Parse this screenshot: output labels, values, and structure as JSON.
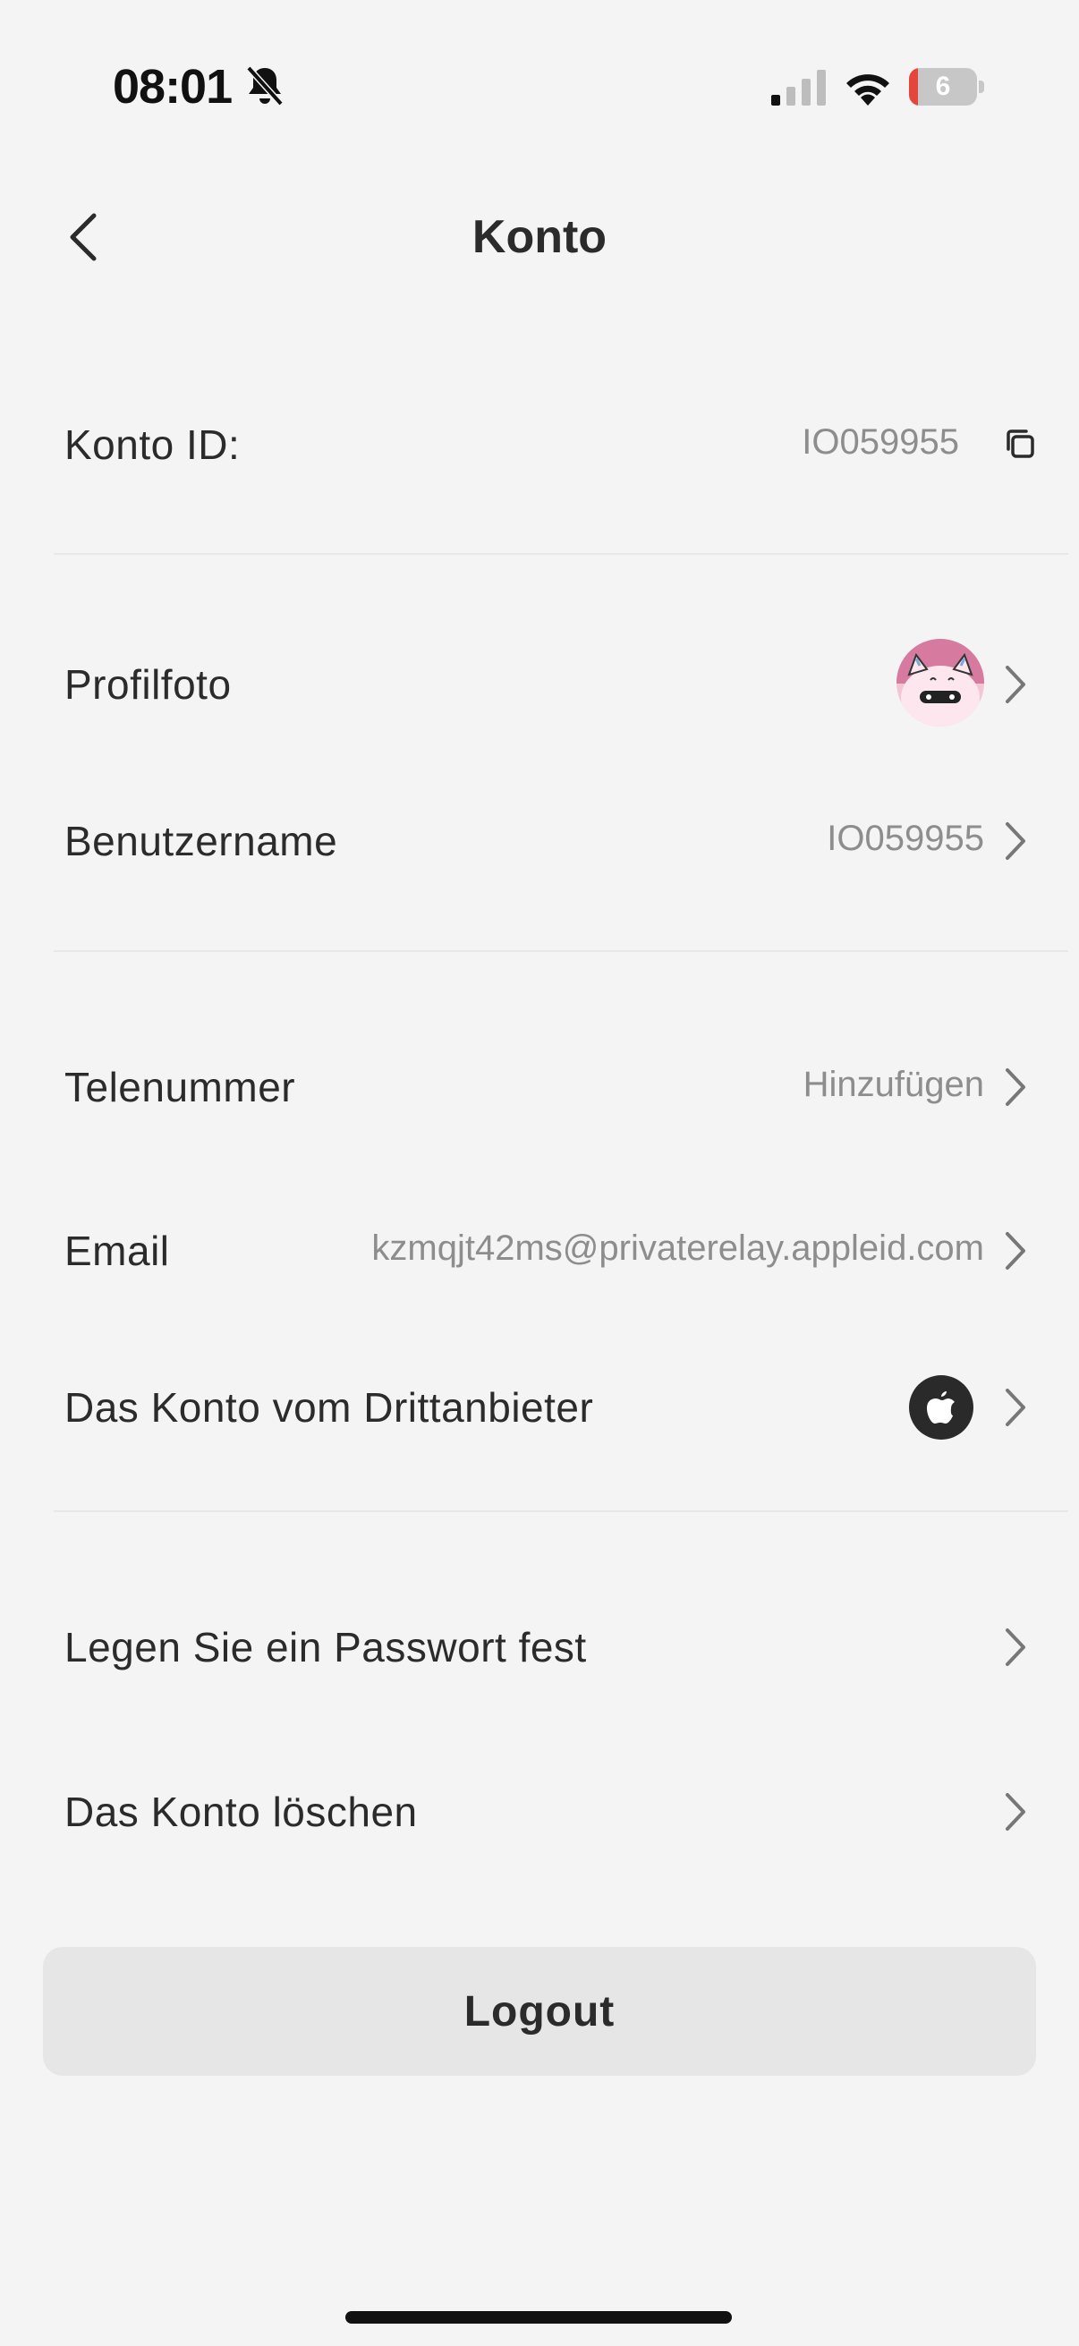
{
  "status_bar": {
    "time": "08:01",
    "battery_level": "6",
    "icons": [
      "bell-slash-icon",
      "cellular-signal-icon",
      "wifi-icon",
      "battery-icon"
    ]
  },
  "nav": {
    "title": "Konto",
    "back_icon": "chevron-left-icon"
  },
  "account_id": {
    "label": "Konto ID:",
    "value": "IO059955",
    "icon": "copy-icon"
  },
  "profile": {
    "photo_label": "Profilfoto",
    "username_label": "Benutzername",
    "username_value": "IO059955"
  },
  "contact": {
    "phone_label": "Telenummer",
    "phone_value": "Hinzufügen",
    "email_label": "Email",
    "email_value": "kzmqjt42ms@privaterelay.appleid.com",
    "third_party_label": "Das Konto vom Drittanbieter",
    "third_party_icon": "apple-logo-icon"
  },
  "security": {
    "password_label": "Legen Sie ein Passwort fest",
    "delete_label": "Das Konto löschen"
  },
  "logout": {
    "label": "Logout"
  },
  "colors": {
    "background": "#f4f4f4",
    "text": "#2b2b2b",
    "secondary_text": "#8d8d8d",
    "button_bg": "#e6e6e6",
    "battery_low": "#e5463c"
  }
}
